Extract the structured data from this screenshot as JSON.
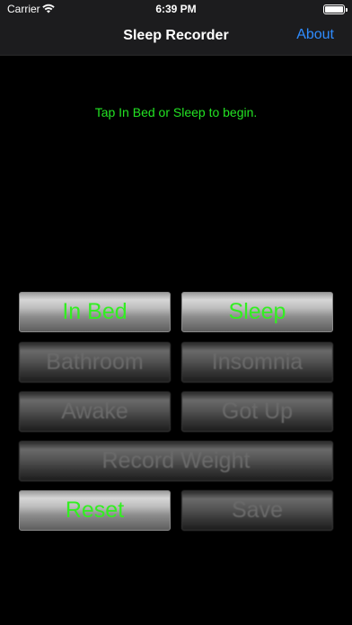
{
  "status_bar": {
    "carrier": "Carrier",
    "time": "6:39 PM",
    "wifi_icon": "wifi-icon",
    "battery_icon": "battery-icon"
  },
  "nav": {
    "title": "Sleep Recorder",
    "about_label": "About"
  },
  "prompt": "Tap In Bed or Sleep to begin.",
  "buttons": {
    "in_bed": "In Bed",
    "sleep": "Sleep",
    "bathroom": "Bathroom",
    "insomnia": "Insomnia",
    "awake": "Awake",
    "got_up": "Got Up",
    "record_weight": "Record Weight",
    "reset": "Reset",
    "save": "Save"
  },
  "colors": {
    "active_text": "#33ee22",
    "prompt_text": "#23e323",
    "link": "#2f8cff",
    "inactive_text": "#6a6a6a"
  }
}
